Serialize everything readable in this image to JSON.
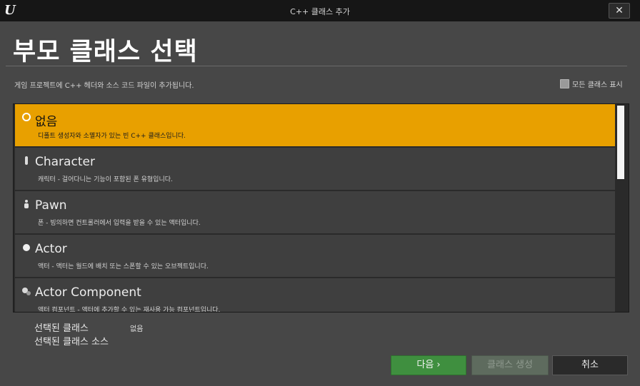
{
  "window": {
    "title": "C++ 클래스 추가",
    "close_symbol": "✕",
    "logo_letter": "U"
  },
  "page": {
    "heading": "부모 클래스 선택",
    "description": "게임 프로젝트에 C++ 헤더와 소스 코드 파일이 추가됩니다.",
    "show_all_label": "모든 클래스 표시"
  },
  "class_list": [
    {
      "name": "없음",
      "description": "디폴트 생성자와 소멸자가 있는 빈 C++ 클래스입니다.",
      "icon": "circle-outline-icon"
    },
    {
      "name": "Character",
      "description": "캐릭터 - 걸어다니는 기능이 포함된 폰 유형입니다.",
      "icon": "character-icon"
    },
    {
      "name": "Pawn",
      "description": "폰 - 빙의하면 컨트롤러에서 입력을 받을 수 있는 액터입니다.",
      "icon": "pawn-icon"
    },
    {
      "name": "Actor",
      "description": "액터 - 액터는 월드에 배치 또는 스폰할 수 있는 오브젝트입니다.",
      "icon": "actor-sphere-icon"
    },
    {
      "name": "Actor Component",
      "description": "액터 컴포넌트 - 액터에 추가할 수 있는 재사용 가능 컴포넌트입니다.",
      "icon": "actor-component-icon"
    }
  ],
  "selection": {
    "selected_class_label": "선택된 클래스",
    "selected_class_value": "없음",
    "selected_source_label": "선택된 클래스 소스"
  },
  "buttons": {
    "next": "다음 ›",
    "create": "클래스 생성",
    "cancel": "취소"
  },
  "colors": {
    "selected_row": "#e8a000",
    "next_button": "#3f8f3f"
  }
}
